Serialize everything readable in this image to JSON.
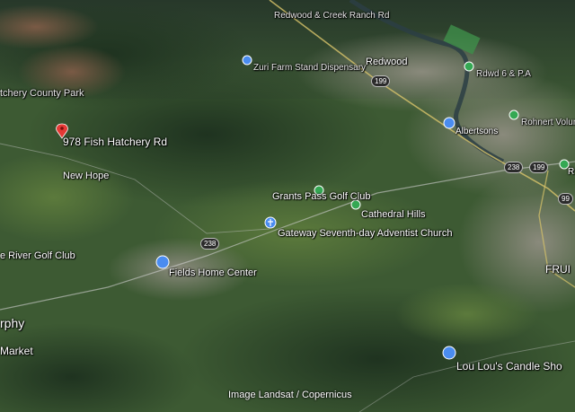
{
  "map": {
    "credit": "Image Landsat / Copernicus",
    "pin": {
      "label": "978 Fish Hatchery Rd",
      "icon": "location-pin-icon",
      "color": "#e53935"
    },
    "places": [
      {
        "name": "Redwood"
      },
      {
        "name": "New Hope"
      },
      {
        "name": "Grants Pass Golf Club"
      },
      {
        "name": "Cathedral Hills"
      },
      {
        "name": "Gateway Seventh-day Adventist Church"
      },
      {
        "name": "Fields Home Center"
      },
      {
        "name": "Lou Lou's Candle Sho"
      },
      {
        "name": "Albertsons"
      },
      {
        "name": "Zuri Farm Stand Dispensary"
      },
      {
        "name": "Rdwd 6 & P.A"
      },
      {
        "name": "Rohnert Volunte"
      },
      {
        "name": "e River Golf Club"
      },
      {
        "name": "rphy"
      },
      {
        "name": "Market"
      },
      {
        "name": "FRUI"
      },
      {
        "name": "tchery County Park"
      },
      {
        "name": "Redwood & Creek Ranch Rd"
      },
      {
        "name": "R"
      }
    ],
    "routes": [
      "238",
      "199",
      "238",
      "199",
      "99"
    ],
    "colors": {
      "green_poi": "#34a853",
      "blue_poi": "#4a8cf0",
      "road": "#d9c46a"
    }
  }
}
